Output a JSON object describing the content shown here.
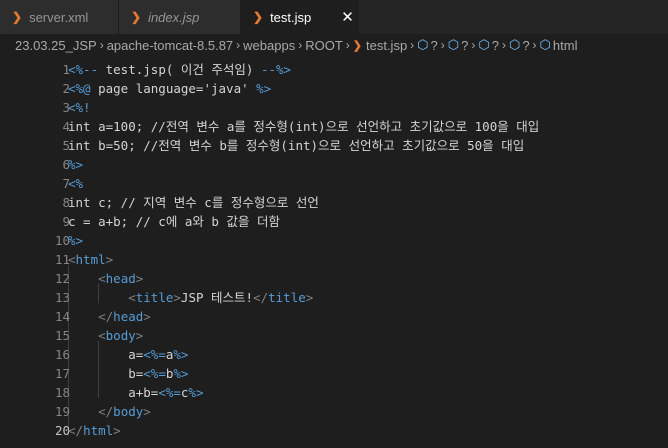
{
  "tabs": [
    {
      "label": "server.xml",
      "icon": "xml-file-icon",
      "italic": false,
      "active": false
    },
    {
      "label": "index.jsp",
      "icon": "jsp-file-icon",
      "italic": true,
      "active": false
    },
    {
      "label": "test.jsp",
      "icon": "jsp-file-icon",
      "italic": false,
      "active": true,
      "close": "✕"
    }
  ],
  "breadcrumb": {
    "segments": [
      "23.03.25_JSP",
      "apache-tomcat-8.5.87",
      "webapps",
      "ROOT"
    ],
    "file": "test.jsp",
    "symbols": [
      "?",
      "?",
      "?",
      "?"
    ],
    "last": "html",
    "sep": "›"
  },
  "editor": {
    "current_line": 20,
    "lines": [
      {
        "n": "1",
        "text": "<%-- test.jsp( 이건 주석임) --%>"
      },
      {
        "n": "2",
        "text": "<%@ page language='java' %>"
      },
      {
        "n": "3",
        "text": "<%!"
      },
      {
        "n": "4",
        "text": "int a=100; //전역 변수 a를 정수형(int)으로 선언하고 초기값으로 100을 대입"
      },
      {
        "n": "5",
        "text": "int b=50; //전역 변수 b를 정수형(int)으로 선언하고 초기값으로 50을 대입"
      },
      {
        "n": "6",
        "text": "%>"
      },
      {
        "n": "7",
        "text": "<%"
      },
      {
        "n": "8",
        "text": "int c; // 지역 변수 c를 정수형으로 선언"
      },
      {
        "n": "9",
        "text": "c = a+b; // c에 a와 b 값을 더함"
      },
      {
        "n": "10",
        "text": "%>"
      },
      {
        "n": "11",
        "text": "<html>"
      },
      {
        "n": "12",
        "text": "    <head>"
      },
      {
        "n": "13",
        "text": "        <title>JSP 테스트!</title>"
      },
      {
        "n": "14",
        "text": "    </head>"
      },
      {
        "n": "15",
        "text": "    <body>"
      },
      {
        "n": "16",
        "text": "        a=<%=a%>"
      },
      {
        "n": "17",
        "text": "        b=<%=b%>"
      },
      {
        "n": "18",
        "text": "        a+b=<%=c%>"
      },
      {
        "n": "19",
        "text": "    </body>"
      },
      {
        "n": "20",
        "text": "</html>"
      }
    ]
  },
  "colors": {
    "background": "#1e1e1e",
    "tag": "#569cd6",
    "jsp_delimiter": "#569cd6",
    "text": "#d4d4d4",
    "line_number": "#858585",
    "file_icon": "#e37933"
  }
}
